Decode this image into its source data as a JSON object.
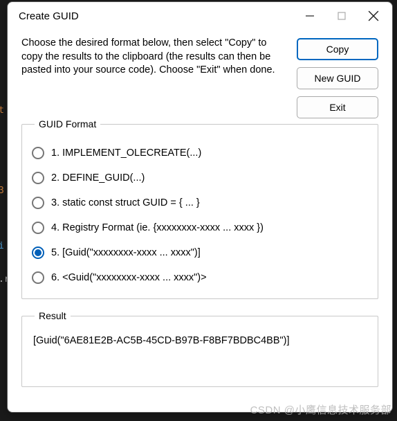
{
  "window": {
    "title": "Create GUID"
  },
  "instructions": "Choose the desired format below, then select \"Copy\" to copy the results to the clipboard (the results can then be pasted into your source code).  Choose \"Exit\" when done.",
  "buttons": {
    "copy": "Copy",
    "new_guid": "New GUID",
    "exit": "Exit"
  },
  "format": {
    "legend": "GUID Format",
    "selected_index": 4,
    "options": [
      "1. IMPLEMENT_OLECREATE(...)",
      "2. DEFINE_GUID(...)",
      "3. static const struct GUID = { ... }",
      "4. Registry Format (ie. {xxxxxxxx-xxxx ... xxxx })",
      "5. [Guid(\"xxxxxxxx-xxxx ... xxxx\")]",
      "6. <Guid(\"xxxxxxxx-xxxx ... xxxx\")>"
    ]
  },
  "result": {
    "legend": "Result",
    "value": "[Guid(\"6AE81E2B-AC5B-45CD-B97B-F8BF7BDBC4BB\")]"
  },
  "watermark": "CSDN @小鹰信息技术服务部"
}
